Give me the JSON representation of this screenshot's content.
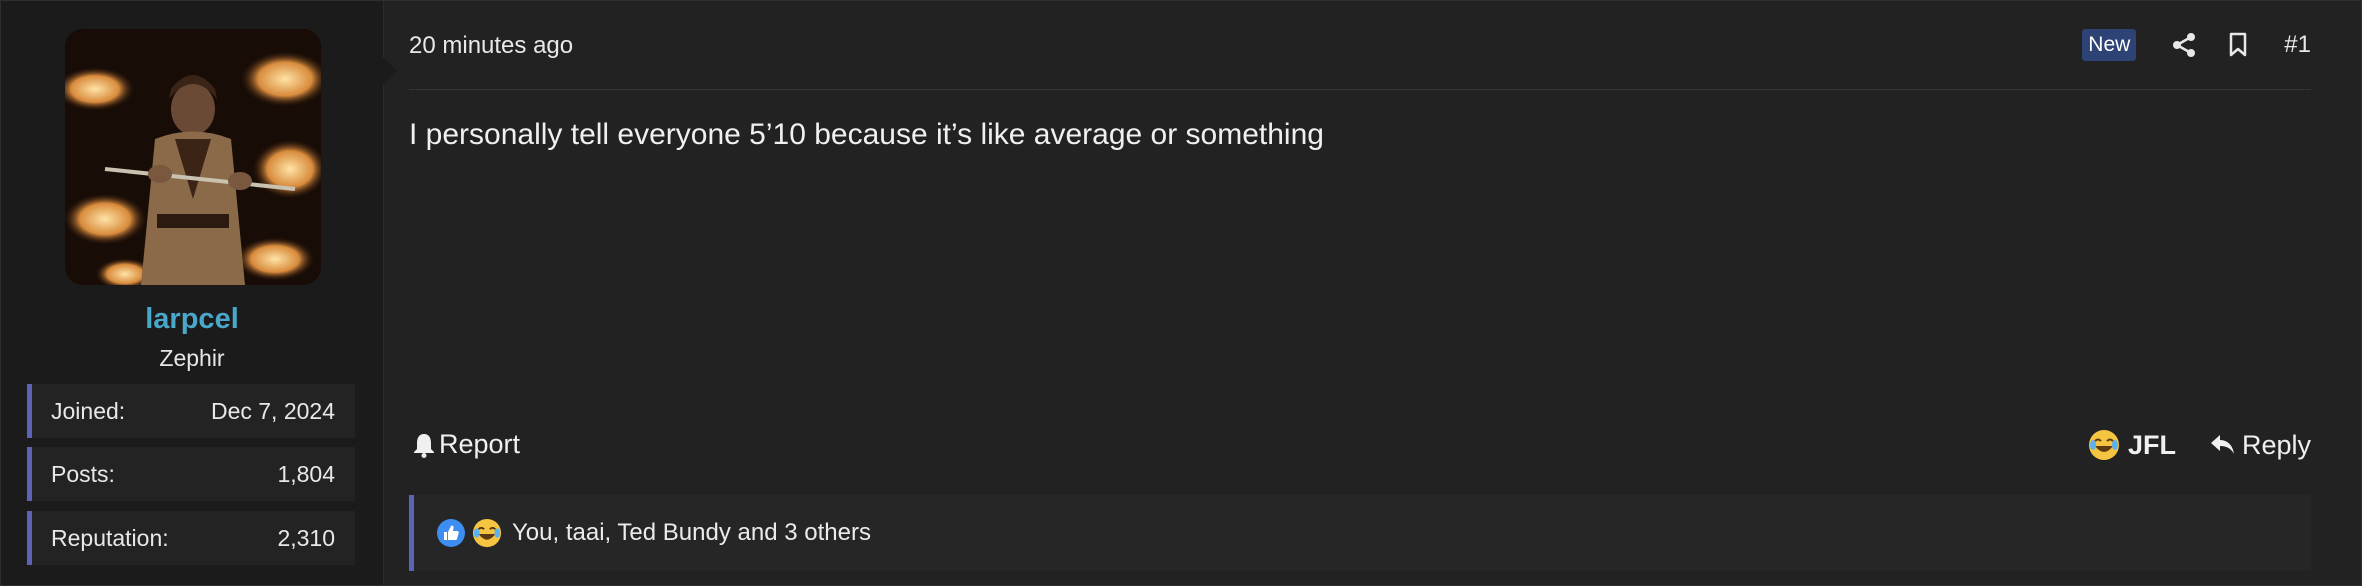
{
  "user": {
    "name": "larpcel",
    "title": "Zephir",
    "stats": [
      {
        "label": "Joined:",
        "value": "Dec 7, 2024"
      },
      {
        "label": "Posts:",
        "value": "1,804"
      },
      {
        "label": "Reputation:",
        "value": "2,310"
      }
    ]
  },
  "post": {
    "timestamp": "20 minutes ago",
    "badge": "New",
    "number": "#1",
    "message": "I personally tell everyone 5’10 because it’s like average or something"
  },
  "actions": {
    "report_label": "Report",
    "reaction_label": "JFL",
    "reply_label": "Reply"
  },
  "reactions": {
    "icons": [
      "like-icon",
      "laugh-icon"
    ],
    "summary": "You, taai, Ted Bundy and 3 others"
  },
  "colors": {
    "username": "#4aa7c9",
    "accent_bar": "#5c63b6",
    "badge_bg": "#2d4275",
    "background": "#222222"
  }
}
